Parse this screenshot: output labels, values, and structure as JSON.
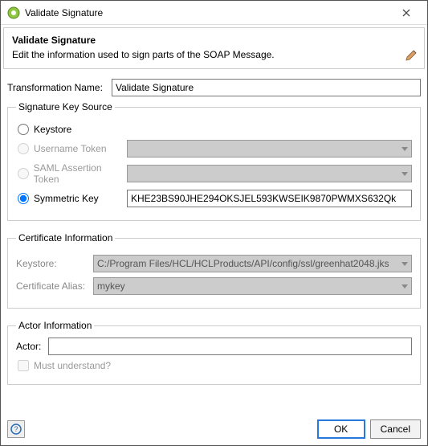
{
  "window": {
    "title": "Validate Signature"
  },
  "header": {
    "title": "Validate Signature",
    "subtitle": "Edit the information used to sign parts of the SOAP Message."
  },
  "form": {
    "transformationNameLabel": "Transformation Name:",
    "transformationName": "Validate Signature"
  },
  "keySource": {
    "legend": "Signature Key Source",
    "options": {
      "keystore": {
        "label": "Keystore",
        "selected": false,
        "enabled": true,
        "value": ""
      },
      "usernameToken": {
        "label": "Username Token",
        "selected": false,
        "enabled": false,
        "value": ""
      },
      "samlToken": {
        "label": "SAML Assertion Token",
        "selected": false,
        "enabled": false,
        "value": ""
      },
      "symmetricKey": {
        "label": "Symmetric Key",
        "selected": true,
        "enabled": true,
        "value": "KHE23BS90JHE294OKSJEL593KWSEIK9870PWMXS632Qk"
      }
    }
  },
  "certInfo": {
    "legend": "Certificate Information",
    "keystoreLabel": "Keystore:",
    "keystoreValue": "C:/Program Files/HCL/HCLProducts/API/config/ssl/greenhat2048.jks",
    "aliasLabel": "Certificate Alias:",
    "aliasValue": "mykey"
  },
  "actorInfo": {
    "legend": "Actor Information",
    "actorLabel": "Actor:",
    "actorValue": "",
    "mustUnderstandLabel": "Must understand?",
    "mustUnderstandChecked": false
  },
  "footer": {
    "ok": "OK",
    "cancel": "Cancel"
  }
}
